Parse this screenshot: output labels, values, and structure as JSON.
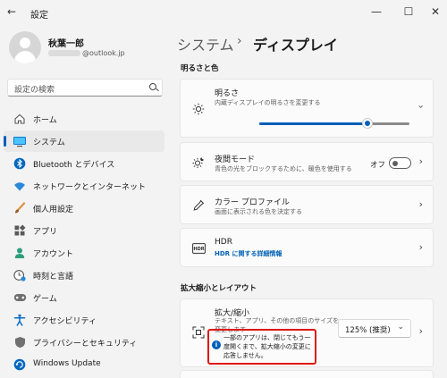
{
  "window": {
    "title": "設定",
    "minimize": "—",
    "maximize": "☐",
    "close": "✕"
  },
  "user": {
    "name": "秋葉一郎",
    "email_suffix": "@outlook.jp"
  },
  "search": {
    "placeholder": "設定の検索"
  },
  "sidebar": {
    "items": [
      {
        "label": "ホーム",
        "icon": "home-icon",
        "selected": false
      },
      {
        "label": "システム",
        "icon": "system-icon",
        "selected": true
      },
      {
        "label": "Bluetooth とデバイス",
        "icon": "bluetooth-icon",
        "selected": false
      },
      {
        "label": "ネットワークとインターネット",
        "icon": "wifi-icon",
        "selected": false
      },
      {
        "label": "個人用設定",
        "icon": "brush-icon",
        "selected": false
      },
      {
        "label": "アプリ",
        "icon": "apps-icon",
        "selected": false
      },
      {
        "label": "アカウント",
        "icon": "account-icon",
        "selected": false
      },
      {
        "label": "時刻と言語",
        "icon": "time-language-icon",
        "selected": false
      },
      {
        "label": "ゲーム",
        "icon": "gaming-icon",
        "selected": false
      },
      {
        "label": "アクセシビリティ",
        "icon": "accessibility-icon",
        "selected": false
      },
      {
        "label": "プライバシーとセキュリティ",
        "icon": "shield-icon",
        "selected": false
      },
      {
        "label": "Windows Update",
        "icon": "windows-update-icon",
        "selected": false
      }
    ]
  },
  "breadcrumb": {
    "parent": "システム",
    "separator": "›",
    "current": "ディスプレイ"
  },
  "sections": {
    "brightness_color": "明るさと色",
    "scale_layout": "拡大縮小とレイアウト"
  },
  "brightness": {
    "title": "明るさ",
    "subtitle": "内蔵ディスプレイの明るさを変更する",
    "value_fraction": 0.72
  },
  "night_light": {
    "title": "夜間モード",
    "subtitle": "青色の光をブロックするために、暖色を使用する",
    "state_label": "オフ",
    "on": false
  },
  "color_profile": {
    "title": "カラー プロファイル",
    "subtitle": "画面に表示される色を決定する"
  },
  "hdr": {
    "title": "HDR",
    "link": "HDR に関する詳細情報"
  },
  "scale": {
    "title": "拡大/縮小",
    "subtitle_lines": [
      "テキスト、アプリ、その他の項目のサイズを",
      "変更します"
    ],
    "value": "125% (推奨)",
    "warning": "一部のアプリは、閉じてもう一度開くまで、拡大縮小の変更に応答しません。"
  },
  "colors": {
    "accent": "#005fb8",
    "highlight_border": "#e01515"
  }
}
